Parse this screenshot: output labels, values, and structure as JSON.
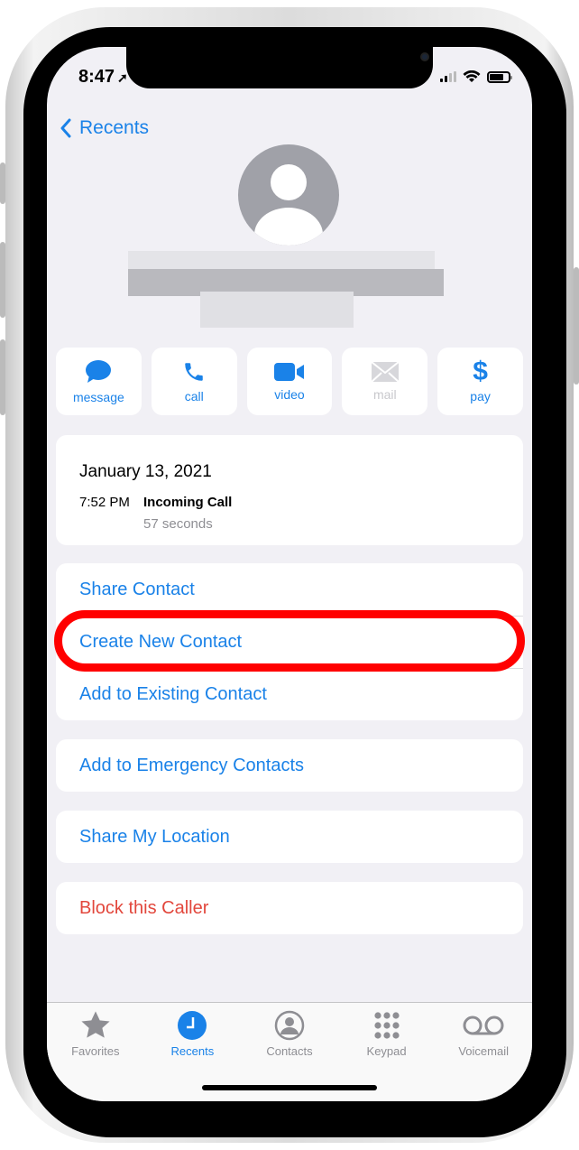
{
  "status_bar": {
    "time": "8:47",
    "location_icon": "location-arrow-icon"
  },
  "nav": {
    "back_label": "Recents"
  },
  "contact": {
    "name": "",
    "avatar_icon": "person-silhouette-icon"
  },
  "actions": [
    {
      "label": "message",
      "icon": "message-bubble-icon",
      "enabled": true
    },
    {
      "label": "call",
      "icon": "phone-icon",
      "enabled": true
    },
    {
      "label": "video",
      "icon": "video-camera-icon",
      "enabled": true
    },
    {
      "label": "mail",
      "icon": "envelope-icon",
      "enabled": false
    },
    {
      "label": "pay",
      "icon": "dollar-icon",
      "enabled": true
    }
  ],
  "call_log": {
    "date": "January 13, 2021",
    "time": "7:52 PM",
    "type": "Incoming Call",
    "duration": "57 seconds"
  },
  "menu": {
    "group1": [
      "Share Contact",
      "Create New Contact",
      "Add to Existing Contact"
    ],
    "emergency": "Add to Emergency Contacts",
    "share_location": "Share My Location",
    "block": "Block this Caller"
  },
  "annotation": {
    "highlighted_item": "Create New Contact",
    "color": "#ff0000"
  },
  "tabbar": [
    {
      "label": "Favorites",
      "icon": "star-icon",
      "active": false
    },
    {
      "label": "Recents",
      "icon": "clock-icon",
      "active": true
    },
    {
      "label": "Contacts",
      "icon": "person-circle-icon",
      "active": false
    },
    {
      "label": "Keypad",
      "icon": "keypad-icon",
      "active": false
    },
    {
      "label": "Voicemail",
      "icon": "voicemail-icon",
      "active": false
    }
  ],
  "colors": {
    "accent": "#1a82e8",
    "destructive": "#e2473c",
    "background": "#f1f0f5"
  }
}
